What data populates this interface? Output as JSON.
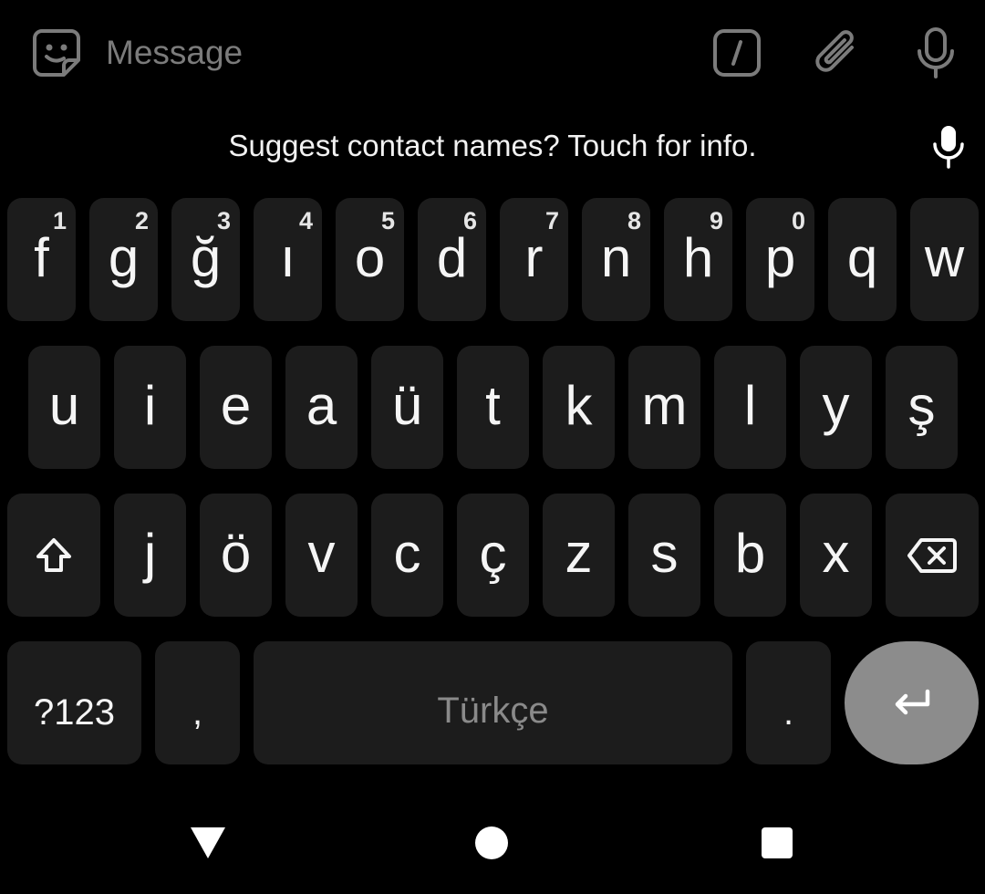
{
  "compose": {
    "placeholder": "Message",
    "icons": [
      "sticker-icon",
      "slash-command-icon",
      "attach-icon",
      "microphone-icon"
    ]
  },
  "suggestion": {
    "text": "Suggest contact names? Touch for info.",
    "icon": "microphone-icon"
  },
  "keyboard": {
    "row1": [
      {
        "key": "f",
        "hint": "1"
      },
      {
        "key": "g",
        "hint": "2"
      },
      {
        "key": "ğ",
        "hint": "3"
      },
      {
        "key": "ı",
        "hint": "4"
      },
      {
        "key": "o",
        "hint": "5"
      },
      {
        "key": "d",
        "hint": "6"
      },
      {
        "key": "r",
        "hint": "7"
      },
      {
        "key": "n",
        "hint": "8"
      },
      {
        "key": "h",
        "hint": "9"
      },
      {
        "key": "p",
        "hint": "0"
      },
      {
        "key": "q",
        "hint": ""
      },
      {
        "key": "w",
        "hint": ""
      }
    ],
    "row2": [
      "u",
      "i",
      "e",
      "a",
      "ü",
      "t",
      "k",
      "m",
      "l",
      "y",
      "ş"
    ],
    "row3": [
      "j",
      "ö",
      "v",
      "c",
      "ç",
      "z",
      "s",
      "b",
      "x"
    ],
    "symbols_label": "?123",
    "comma": ",",
    "space_label": "Türkçe",
    "period": ".",
    "shift_icon": "shift-icon",
    "backspace_icon": "backspace-icon",
    "enter_icon": "enter-icon"
  },
  "colors": {
    "key_bg": "#1c1c1c",
    "enter_bg": "#8c8c8c",
    "placeholder": "#7b7b7b"
  },
  "nav": {
    "icons": [
      "back-icon",
      "home-icon",
      "recents-icon"
    ]
  }
}
